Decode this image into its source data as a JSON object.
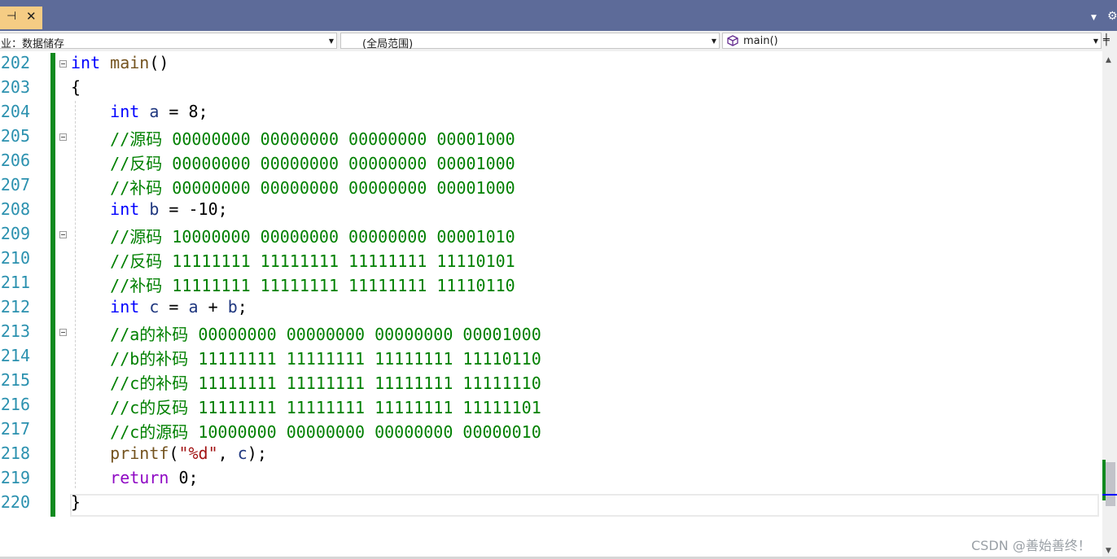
{
  "tab": {
    "pin_icon": "⊣",
    "close_icon": "✕"
  },
  "nav": {
    "project": "业：数据储存",
    "scope": "(全局范围)",
    "member": "main()",
    "member_icon": "cube-icon"
  },
  "lines": [
    {
      "no": "202",
      "code": "int main()"
    },
    {
      "no": "203",
      "code": "{"
    },
    {
      "no": "204",
      "code": "    int a = 8;"
    },
    {
      "no": "205",
      "code": "    //源码 00000000 00000000 00000000 00001000"
    },
    {
      "no": "206",
      "code": "    //反码 00000000 00000000 00000000 00001000"
    },
    {
      "no": "207",
      "code": "    //补码 00000000 00000000 00000000 00001000"
    },
    {
      "no": "208",
      "code": "    int b = -10;"
    },
    {
      "no": "209",
      "code": "    //源码 10000000 00000000 00000000 00001010"
    },
    {
      "no": "210",
      "code": "    //反码 11111111 11111111 11111111 11110101"
    },
    {
      "no": "211",
      "code": "    //补码 11111111 11111111 11111111 11110110"
    },
    {
      "no": "212",
      "code": "    int c = a + b;"
    },
    {
      "no": "213",
      "code": "    //a的补码 00000000 00000000 00000000 00001000"
    },
    {
      "no": "214",
      "code": "    //b的补码 11111111 11111111 11111111 11110110"
    },
    {
      "no": "215",
      "code": "    //c的补码 11111111 11111111 11111111 11111110"
    },
    {
      "no": "216",
      "code": "    //c的反码 11111111 11111111 11111111 11111101"
    },
    {
      "no": "217",
      "code": "    //c的源码 10000000 00000000 00000000 00000010"
    },
    {
      "no": "218",
      "code": "    printf(\"%d\", c);"
    },
    {
      "no": "219",
      "code": "    return 0;"
    },
    {
      "no": "220",
      "code": "}"
    }
  ],
  "watermark": "CSDN @善始善终！",
  "colors": {
    "tab_strip": "#5d6b99",
    "active_tab": "#f5cc84",
    "line_number": "#2b91af",
    "comment": "#008000",
    "keyword": "#0000ff",
    "change_bar": "#108a1f"
  }
}
